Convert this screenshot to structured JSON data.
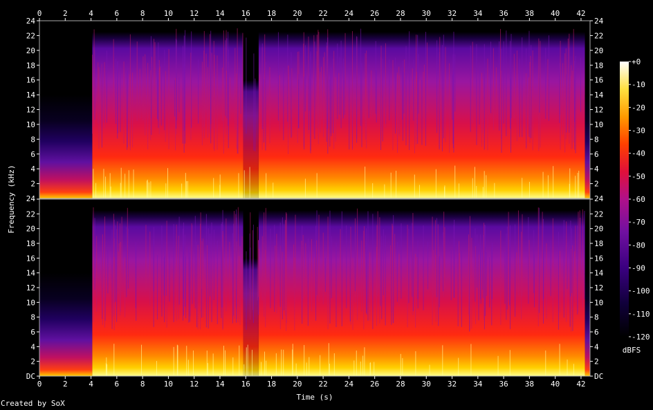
{
  "chart_data": {
    "type": "heatmap",
    "subtype": "spectrogram",
    "channels": 2,
    "x": {
      "label": "Time (s)",
      "range": [
        0,
        42.7
      ],
      "ticks": [
        0,
        2,
        4,
        6,
        8,
        10,
        12,
        14,
        16,
        18,
        20,
        22,
        24,
        26,
        28,
        30,
        32,
        34,
        36,
        38,
        40,
        42
      ]
    },
    "y": {
      "label": "Frequency (kHz)",
      "range": [
        0,
        24
      ],
      "ticks": [
        0,
        2,
        4,
        6,
        8,
        10,
        12,
        14,
        16,
        18,
        20,
        22,
        24
      ],
      "tick_labels": [
        "DC",
        "2",
        "4",
        "6",
        "8",
        "10",
        "12",
        "14",
        "16",
        "18",
        "20",
        "22",
        "24"
      ]
    },
    "colorbar": {
      "label": "dBFS",
      "range": [
        -120,
        0
      ],
      "ticks": [
        0,
        -10,
        -20,
        -30,
        -40,
        -50,
        -60,
        -70,
        -80,
        -90,
        -100,
        -110,
        -120
      ],
      "tick_labels": [
        "+0",
        "-10",
        "-20",
        "-30",
        "-40",
        "-50",
        "-60",
        "-70",
        "-80",
        "-90",
        "-100",
        "-110",
        "-120"
      ],
      "colors": [
        "#000000",
        "#2a0060",
        "#5a0aa0",
        "#9a16a0",
        "#d8104a",
        "#ff2a00",
        "#ff8a00",
        "#ffd000",
        "#ffff80",
        "#ffffff"
      ]
    },
    "segments": [
      {
        "start": 0,
        "end": 4.1,
        "level": "quiet intro, energy mostly below 14 kHz"
      },
      {
        "start": 4.1,
        "end": 15.8,
        "level": "full band up to ~22 kHz"
      },
      {
        "start": 15.8,
        "end": 17.0,
        "level": "dip with transients"
      },
      {
        "start": 17.0,
        "end": 42.3,
        "level": "full band up to ~22 kHz"
      },
      {
        "start": 42.3,
        "end": 42.7,
        "level": "fade out"
      }
    ]
  },
  "footer": {
    "credit": "Created by SoX"
  }
}
